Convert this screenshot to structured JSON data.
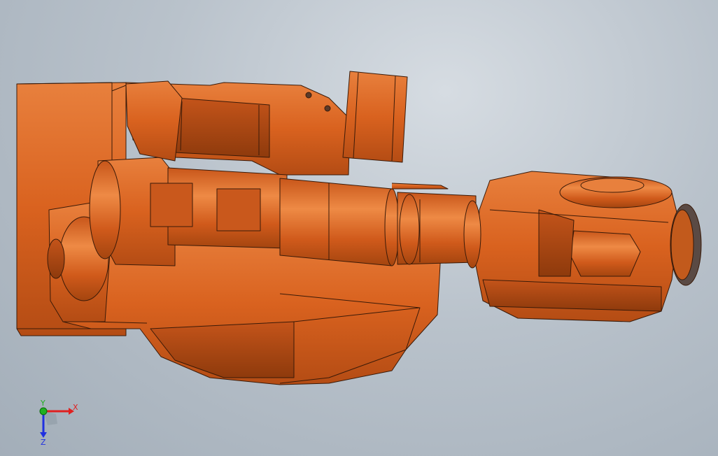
{
  "viewport": {
    "background_top": "#d6dce2",
    "background_bottom": "#a3aeb9"
  },
  "model": {
    "name_icon": "robot-arm-3d-model",
    "body_color": "#d9621f",
    "shade_color": "#b44c14",
    "light_color": "#e8803d",
    "edge_color": "#3a1a08"
  },
  "triad": {
    "x_label": "X",
    "y_label": "Y",
    "z_label": "Z",
    "x_color": "#e02020",
    "y_color": "#20b020",
    "z_color": "#2030e0"
  }
}
